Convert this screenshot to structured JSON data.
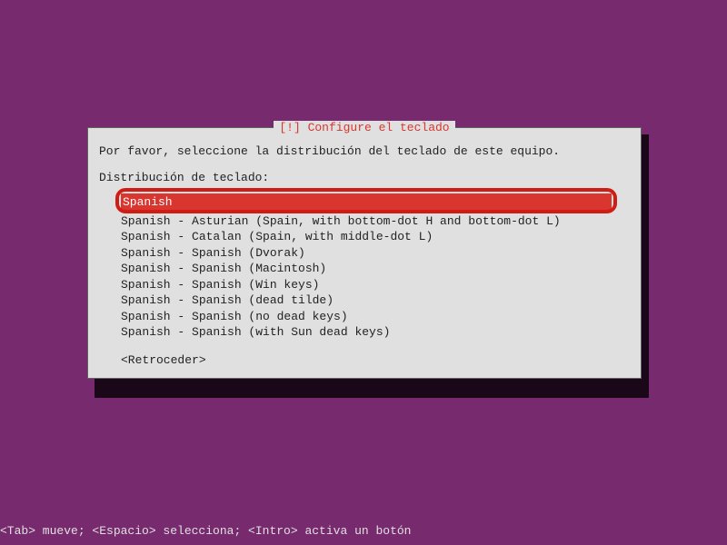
{
  "dialog": {
    "title": "[!] Configure el teclado",
    "prompt": "Por favor, seleccione la distribución del teclado de este equipo.",
    "label": "Distribución de teclado:",
    "items": [
      "Spanish",
      "Spanish - Asturian (Spain, with bottom-dot H and bottom-dot L)",
      "Spanish - Catalan (Spain, with middle-dot L)",
      "Spanish - Spanish (Dvorak)",
      "Spanish - Spanish (Macintosh)",
      "Spanish - Spanish (Win keys)",
      "Spanish - Spanish (dead tilde)",
      "Spanish - Spanish (no dead keys)",
      "Spanish - Spanish (with Sun dead keys)"
    ],
    "selected_index": 0,
    "back": "<Retroceder>"
  },
  "footer": "<Tab> mueve; <Espacio> selecciona; <Intro> activa un botón"
}
